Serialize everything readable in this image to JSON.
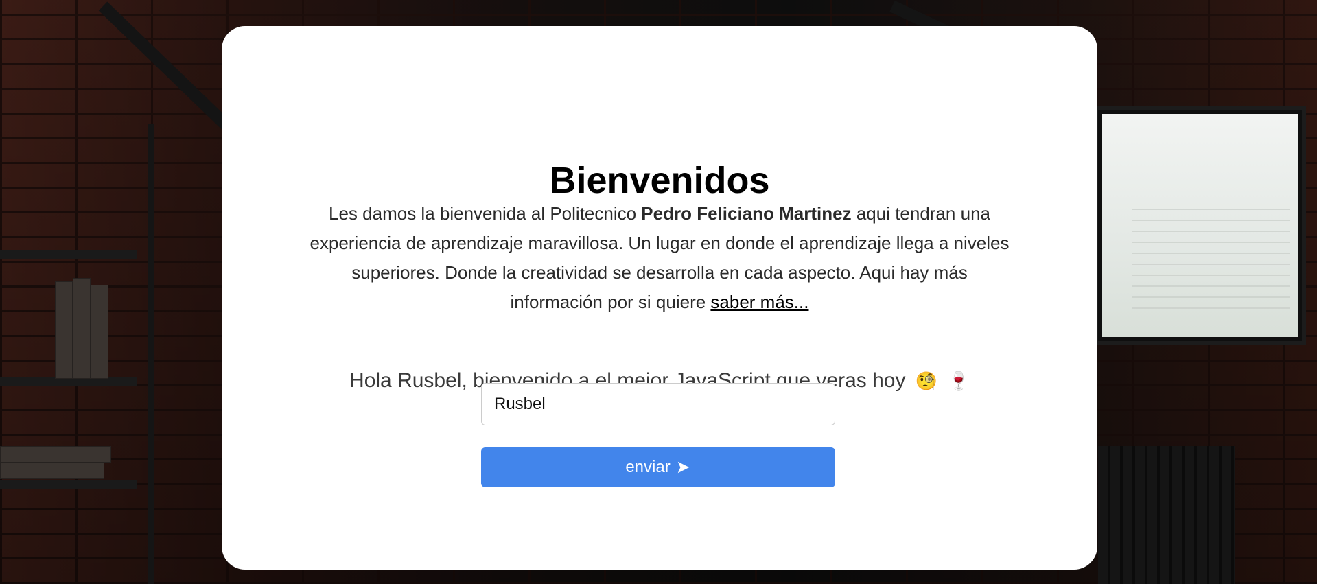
{
  "welcome": {
    "title": "Bienvenidos",
    "intro_before": "Les damos la bienvenida al Politecnico ",
    "institution_name": "Pedro Feliciano Martinez",
    "intro_after": " aqui tendran una experiencia de aprendizaje maravillosa. Un lugar en donde el aprendizaje llega a niveles superiores. Donde la creatividad se desarrolla en cada aspecto. Aqui hay más información por si quiere ",
    "more_link_label": "saber más..."
  },
  "greeting": {
    "text": "Hola Rusbel, bienvenido a el mejor JavaScript que veras hoy",
    "emoji_1": "🧐",
    "emoji_2": "🍷"
  },
  "form": {
    "name_value": "Rusbel",
    "send_label": "enviar",
    "send_icon": "send-arrow-icon"
  },
  "colors": {
    "button_bg": "#4285eb",
    "card_bg": "#ffffff"
  }
}
